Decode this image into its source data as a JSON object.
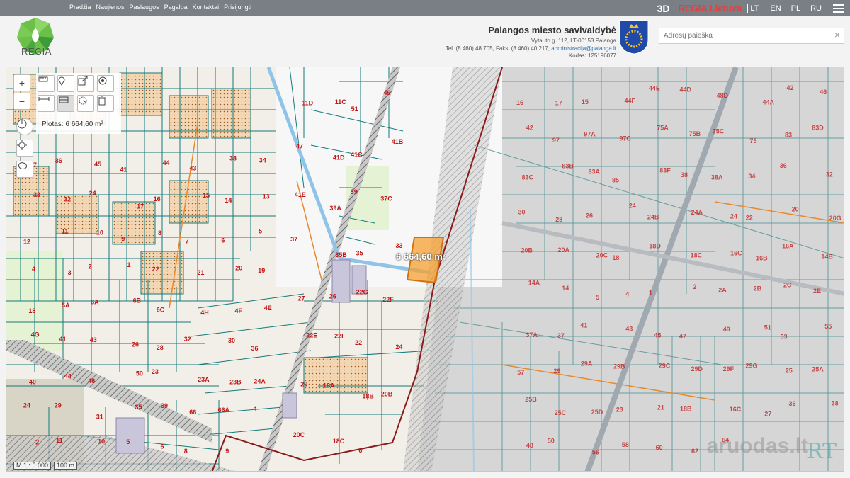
{
  "topbar": {
    "nav": [
      "Pradžia",
      "Naujienos",
      "Paslaugos",
      "Pagalba",
      "Kontaktai",
      "Prisijungti"
    ],
    "btn_3d": "3D",
    "brand": "REGIA Lietuva",
    "languages": [
      "LT",
      "EN",
      "PL",
      "RU"
    ],
    "active_language": "LT"
  },
  "header": {
    "logo_text": "REGIA",
    "municipality": {
      "name": "Palangos miesto savivaldybė",
      "address": "Vytauto g. 112, LT-00153 Palanga",
      "phone": "Tel. (8 460) 48 705, Faks. (8 460) 40 217,",
      "email": "administracija@palanga.lt",
      "code": "Kodas: 125196077"
    },
    "search_placeholder": "Adresų paieška",
    "clear_icon": "×"
  },
  "map": {
    "tools_left": [
      "+",
      "−"
    ],
    "measure_result": "Plotas: 6 664,60 m²",
    "area_label": "6 664,60 m²",
    "scale_ratio": "M 1 : 5 000",
    "scale_bar": "100 m",
    "watermark": "aruodas.lt",
    "watermark_logo": "RT",
    "colors": {
      "parcel": "#147a7a",
      "road": "#9aa0a6",
      "boundary": "#8b1a1a",
      "selection": "#f5a030",
      "orange_line": "#e8882a"
    },
    "labels_left": [
      "37",
      "36",
      "45",
      "41",
      "44",
      "43",
      "38",
      "34",
      "33",
      "32",
      "24",
      "17",
      "16",
      "15",
      "14",
      "13",
      "12",
      "11",
      "10",
      "9",
      "8",
      "7",
      "6",
      "5",
      "4",
      "3",
      "2",
      "1",
      "22",
      "21",
      "20",
      "19",
      "18",
      "5A",
      "6A",
      "6B",
      "6C",
      "4H",
      "4F",
      "4E",
      "4G",
      "41",
      "43",
      "26",
      "28",
      "32",
      "30",
      "36",
      "40",
      "44",
      "46",
      "50",
      "23",
      "23A",
      "23B",
      "24A",
      "24",
      "29",
      "31",
      "35",
      "39",
      "66",
      "66A",
      "1",
      "2",
      "11",
      "10",
      "5",
      "6",
      "8",
      "9"
    ],
    "labels_mid": [
      "11D",
      "11C",
      "51",
      "49",
      "47",
      "41D",
      "41C",
      "41B",
      "41E",
      "39A",
      "39",
      "37C",
      "37",
      "35B",
      "35",
      "33",
      "27",
      "26",
      "22G",
      "22F",
      "22E",
      "22I",
      "22",
      "24",
      "20",
      "18A",
      "18B",
      "20B",
      "20C",
      "18C",
      "6"
    ],
    "labels_right": [
      "16",
      "17",
      "15",
      "44F",
      "44E",
      "44D",
      "48D",
      "44A",
      "42",
      "46",
      "42",
      "97",
      "97A",
      "97C",
      "75A",
      "75B",
      "75C",
      "75",
      "83",
      "83D",
      "83C",
      "83B",
      "83A",
      "85",
      "83F",
      "38",
      "38A",
      "34",
      "36",
      "32",
      "30",
      "28",
      "26",
      "24",
      "24B",
      "24A",
      "24",
      "22",
      "20",
      "20G",
      "20B",
      "20A",
      "20C",
      "18",
      "18D",
      "18C",
      "16C",
      "16B",
      "16A",
      "14B",
      "14A",
      "14",
      "5",
      "4",
      "1",
      "2",
      "2A",
      "2B",
      "2C",
      "2E",
      "37A",
      "37",
      "41",
      "43",
      "45",
      "47",
      "49",
      "51",
      "53",
      "55",
      "57",
      "29",
      "29A",
      "29B",
      "29C",
      "29D",
      "29F",
      "29G",
      "25",
      "25A",
      "25B",
      "25C",
      "25D",
      "23",
      "21",
      "18B",
      "16C",
      "27",
      "36",
      "38",
      "48",
      "50",
      "56",
      "58",
      "60",
      "62",
      "64"
    ]
  }
}
